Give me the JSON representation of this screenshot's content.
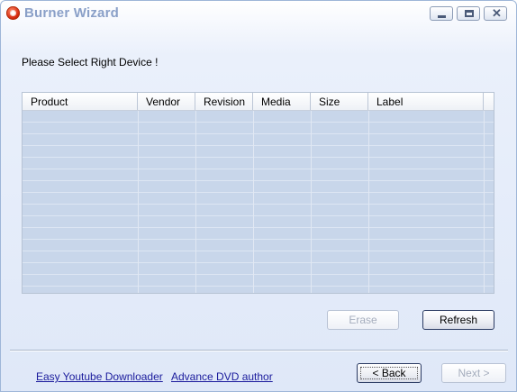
{
  "window": {
    "title": "Burner Wizard",
    "app_icon": "disc-burner-icon"
  },
  "caption_buttons": {
    "minimize": "minimize-icon",
    "maximize": "maximize-icon",
    "close_glyph": "✕"
  },
  "prompt": "Please Select Right Device !",
  "device_table": {
    "columns": [
      "Product",
      "Vendor",
      "Revision",
      "Media",
      "Size",
      "Label"
    ],
    "rows": []
  },
  "buttons": {
    "erase": "Erase",
    "refresh": "Refresh",
    "back": "< Back",
    "next": "Next >"
  },
  "links": {
    "youtube": "Easy Youtube Downloader",
    "dvd": "Advance DVD author"
  },
  "colors": {
    "link": "#1a1a9c",
    "title": "#8aa0c8",
    "grid_body": "#c8d6ea"
  }
}
